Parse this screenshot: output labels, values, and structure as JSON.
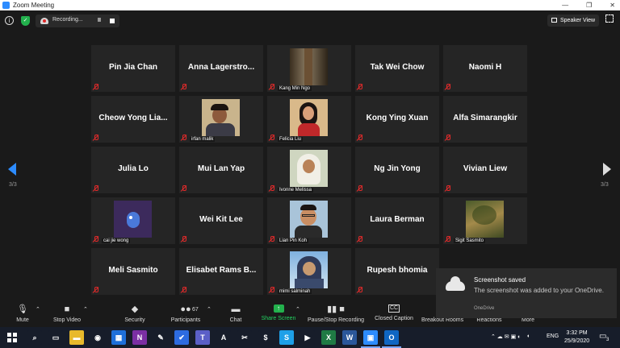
{
  "window": {
    "title": "Zoom Meeting",
    "minimize": "—",
    "maximize": "❐",
    "close": "✕"
  },
  "topbar": {
    "info_icon": "info-icon",
    "recording_label": "Recording...",
    "pause_glyph": "II",
    "speaker_view_label": "Speaker View"
  },
  "gallery": {
    "page_left": "3/3",
    "page_right": "3/3",
    "tiles": [
      {
        "name": "Pin Jia Chan",
        "mode": "text"
      },
      {
        "name": "Anna  Lagerstro...",
        "mode": "text"
      },
      {
        "name": "Kang Min Ngo",
        "mode": "video",
        "photo": "forest-tree"
      },
      {
        "name": "Tak Wei Chow",
        "mode": "text"
      },
      {
        "name": "Naomi H",
        "mode": "text"
      },
      {
        "name": "Cheow  Yong  Lia...",
        "mode": "text"
      },
      {
        "name": "irfan malik",
        "mode": "video",
        "photo": "man"
      },
      {
        "name": "Felicia Liu",
        "mode": "video",
        "photo": "woman-red"
      },
      {
        "name": "Kong Ying Xuan",
        "mode": "text"
      },
      {
        "name": "Alfa Simarangkir",
        "mode": "text"
      },
      {
        "name": "Julia Lo",
        "mode": "text"
      },
      {
        "name": "Mui Lan Yap",
        "mode": "text"
      },
      {
        "name": "Ivonne Melissa",
        "mode": "video",
        "photo": "woman-hijab"
      },
      {
        "name": "Ng Jin Yong",
        "mode": "text"
      },
      {
        "name": "Vivian Liew",
        "mode": "text"
      },
      {
        "name": "cai jie wong",
        "mode": "video",
        "photo": "cartoon"
      },
      {
        "name": "Wei Kit Lee",
        "mode": "text"
      },
      {
        "name": "Lian Pin Koh",
        "mode": "video",
        "photo": "man-glasses"
      },
      {
        "name": "Laura Berman",
        "mode": "text"
      },
      {
        "name": "Sigit Sasmito",
        "mode": "video",
        "photo": "forest"
      },
      {
        "name": "Meli Sasmito",
        "mode": "text"
      },
      {
        "name": "Elisabet  Rams  B...",
        "mode": "text"
      },
      {
        "name": "mimi salminah",
        "mode": "video",
        "photo": "woman-sky"
      },
      {
        "name": "Rupesh  bhomia",
        "mode": "text"
      }
    ]
  },
  "toolbar": {
    "mute": "Mute",
    "stop_video": "Stop Video",
    "security": "Security",
    "participants": "Participants",
    "participants_count": "67",
    "chat": "Chat",
    "share_screen": "Share Screen",
    "pause_stop_recording": "Pause/Stop Recording",
    "closed_caption": "Closed Caption",
    "closed_caption_glyph": "CC",
    "breakout_rooms": "Breakout Rooms",
    "reactions": "Reactions",
    "more": "More"
  },
  "notification": {
    "title": "Screenshot saved",
    "message": "The screenshot was added to your OneDrive.",
    "source": "OneDrive"
  },
  "taskbar": {
    "apps": [
      {
        "id": "search",
        "glyph": "⌕",
        "color": "#171d2a"
      },
      {
        "id": "task-view",
        "glyph": "▭",
        "color": "#171d2a"
      },
      {
        "id": "file-explorer",
        "glyph": "▬",
        "color": "#e8b92b"
      },
      {
        "id": "chrome",
        "glyph": "◉",
        "color": "#171d2a"
      },
      {
        "id": "calendar",
        "glyph": "▦",
        "color": "#1e6fd9"
      },
      {
        "id": "onenote",
        "glyph": "N",
        "color": "#7b2fa3"
      },
      {
        "id": "paint",
        "glyph": "✎",
        "color": "#171d2a"
      },
      {
        "id": "todo",
        "glyph": "✔",
        "color": "#2d6be0"
      },
      {
        "id": "teams",
        "glyph": "T",
        "color": "#5b5fc7"
      },
      {
        "id": "acrobat",
        "glyph": "A",
        "color": "#171d2a"
      },
      {
        "id": "snip",
        "glyph": "✂",
        "color": "#171d2a"
      },
      {
        "id": "money",
        "glyph": "$",
        "color": "#171d2a"
      },
      {
        "id": "skype",
        "glyph": "S",
        "color": "#1ea0e8"
      },
      {
        "id": "media",
        "glyph": "▶",
        "color": "#171d2a"
      },
      {
        "id": "excel",
        "glyph": "X",
        "color": "#1f7a44"
      },
      {
        "id": "word",
        "glyph": "W",
        "color": "#2b579a"
      },
      {
        "id": "zoom",
        "glyph": "▣",
        "color": "#2d8cff"
      },
      {
        "id": "outlook",
        "glyph": "O",
        "color": "#0f66c2"
      }
    ],
    "language": "ENG",
    "time": "3:32 PM",
    "date": "25/9/2020",
    "notification_count": "3"
  }
}
